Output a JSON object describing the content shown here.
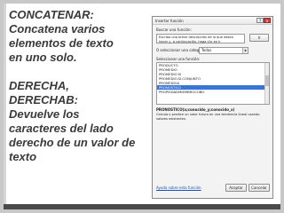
{
  "slide": {
    "lines": [
      "CONCATENAR:",
      "Concatena varios",
      "elementos de texto",
      "en uno solo.",
      "",
      "DERECHA,",
      "DERECHAB:",
      "Devuelve los",
      "caracteres del lado",
      "derecho de un valor de",
      "texto"
    ]
  },
  "dialog": {
    "title": "Insertar función",
    "help_btn": "?",
    "close_btn": "x",
    "search_label": "Buscar una función:",
    "search_value": "Escriba una breve descripción de lo que desea hacer y, a continuación, haga clic en Ir",
    "go_button": "Ir",
    "category_label": "O seleccionar una categoría:",
    "category_value": "Todas",
    "select_label": "Seleccionar una función:",
    "functions": [
      "PRODUCTO",
      "PROMEDIO",
      "PROMEDIO.SI",
      "PROMEDIO.SI.CONJUNTO",
      "PROMEDIOA",
      "PRONOSTICO",
      "PROPIEDADMIEMBROCUBO"
    ],
    "selected_index": 5,
    "signature": "PRONOSTICO(x;conocido_y;conocido_x)",
    "description": "Calcula o predice un valor futuro en una tendencia lineal usando valores existentes.",
    "help_link": "Ayuda sobre esta función",
    "ok_button": "Aceptar",
    "cancel_button": "Cancelar"
  }
}
